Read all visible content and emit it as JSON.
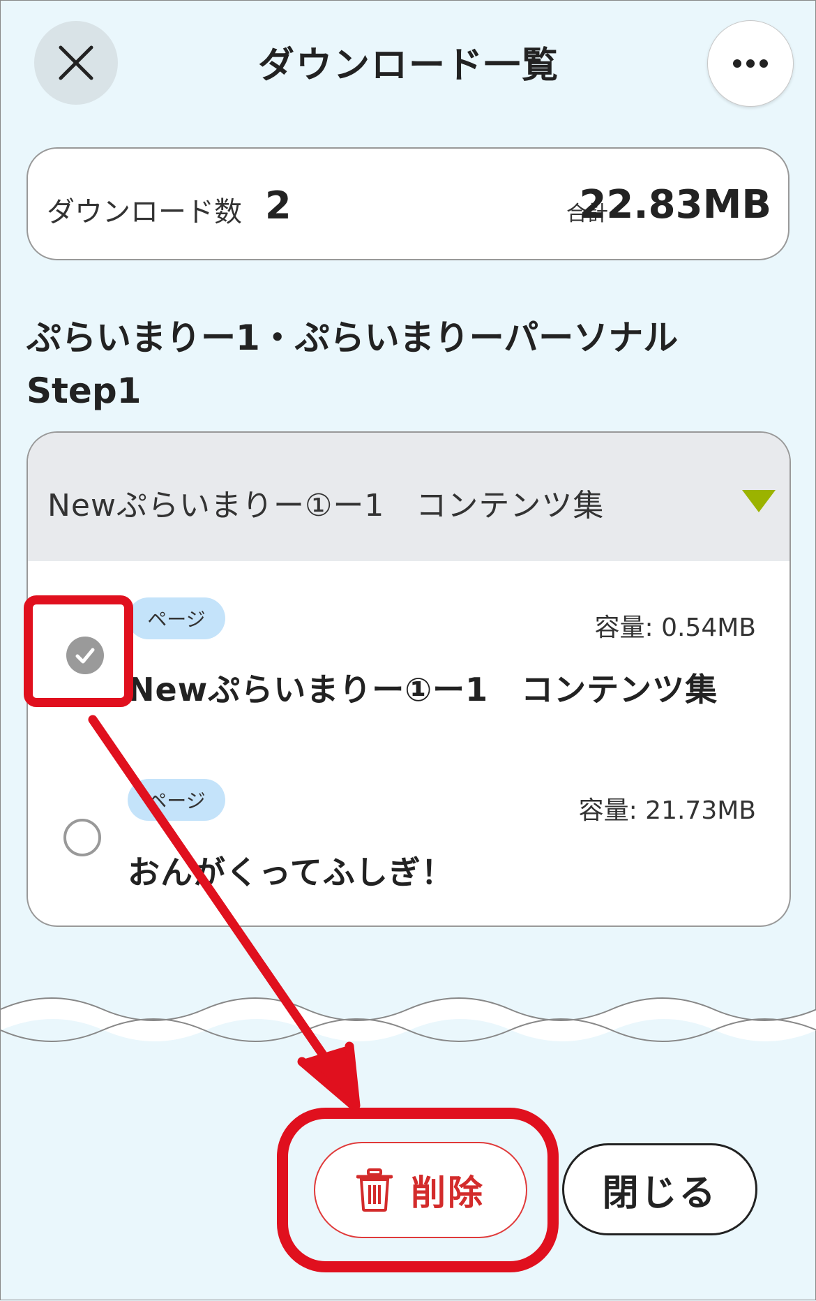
{
  "header": {
    "title": "ダウンロード一覧",
    "close_icon": "close-icon",
    "more_icon": "more-horizontal-icon"
  },
  "summary": {
    "count_label": "ダウンロード数",
    "count_value": "2",
    "total_label": "合計",
    "total_value": "22.83MB"
  },
  "section": {
    "title_line1": "ぷらいまりー1・ぷらいまりーパーソナル",
    "title_line2": "Step1"
  },
  "group": {
    "title": "Newぷらいまりー①ー1　コンテンツ集",
    "caret_color": "#9bb300",
    "items": [
      {
        "tag": "ページ",
        "size": "容量: 0.54MB",
        "title": "Newぷらいまりー①ー1　コンテンツ集",
        "checked": true
      },
      {
        "tag": "ページ",
        "size": "容量: 21.73MB",
        "title": "おんがくってふしぎ！",
        "checked": false
      }
    ]
  },
  "footer": {
    "delete_label": "削除",
    "delete_icon": "trash-icon",
    "close_label": "閉じる"
  },
  "colors": {
    "background": "#eaf7fc",
    "annotation_red": "#e0101e",
    "delete_red": "#d32b2b",
    "tag_blue": "#c4e3fa"
  }
}
